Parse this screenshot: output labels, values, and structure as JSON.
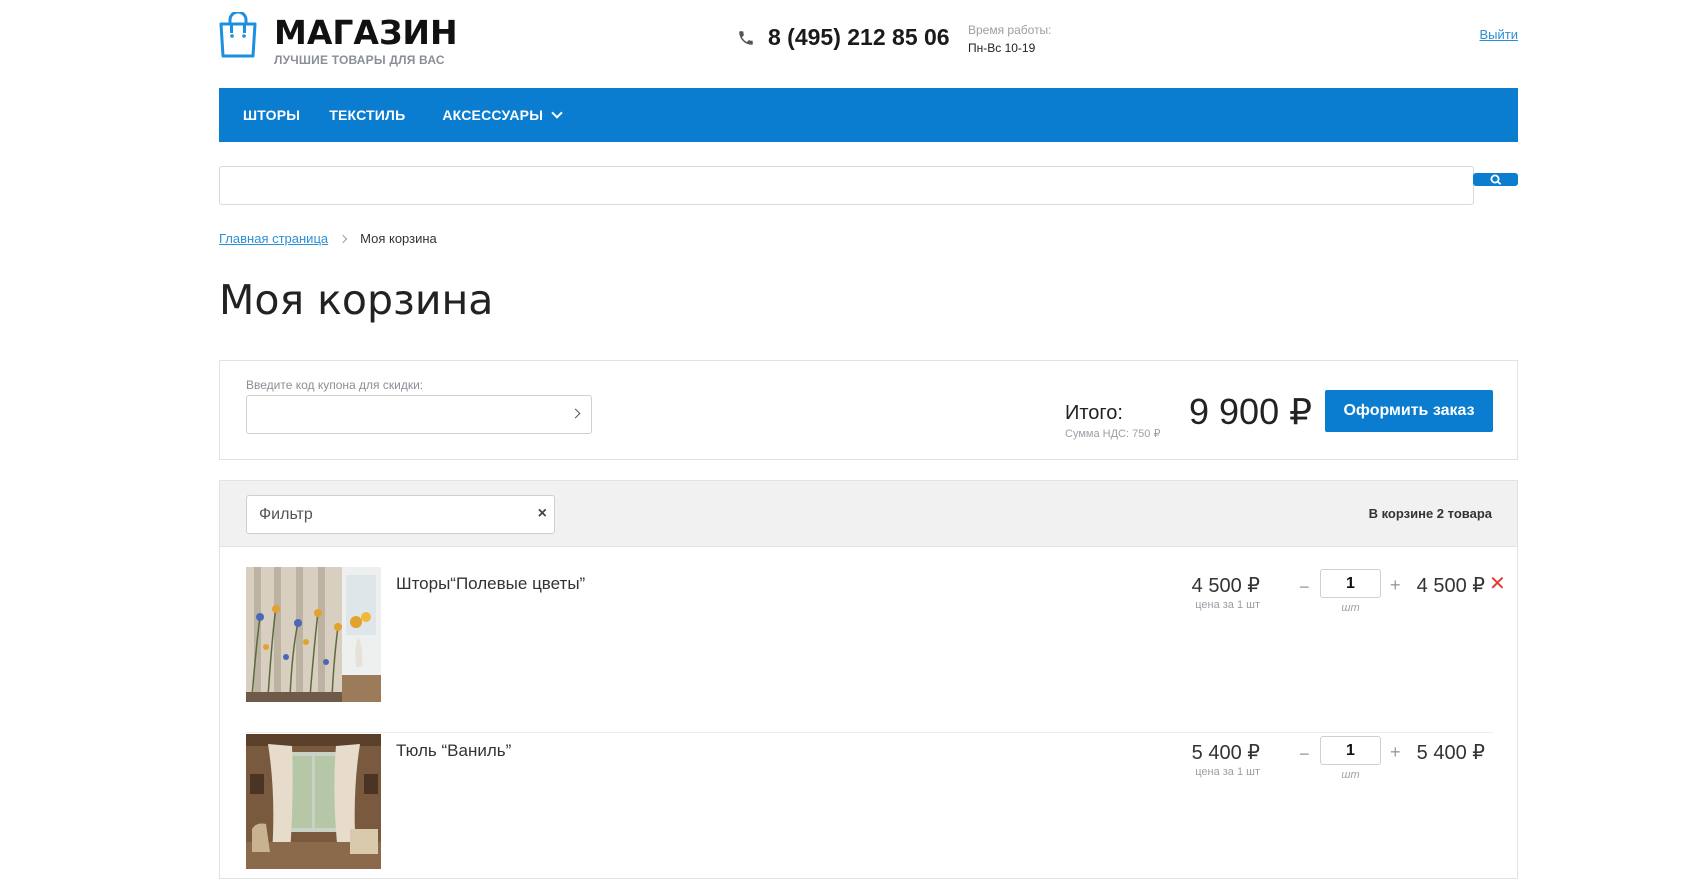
{
  "header": {
    "logo_title": "МАГАЗИН",
    "logo_subtitle": "ЛУЧШИЕ ТОВАРЫ ДЛЯ ВАС",
    "phone": "8 (495) 212 85 06",
    "hours_label": "Время работы:",
    "hours_value": "Пн-Вс 10-19",
    "logout": "Выйти"
  },
  "nav": {
    "items": [
      {
        "label": "ШТОРЫ"
      },
      {
        "label": "ТЕКСТИЛЬ"
      },
      {
        "label": "АКСЕССУАРЫ"
      }
    ]
  },
  "breadcrumb": {
    "home": "Главная страница",
    "current": "Моя корзина"
  },
  "page_title": "Моя корзина",
  "summary": {
    "coupon_label": "Введите код купона для скидки:",
    "coupon_value": "",
    "total_label": "Итого:",
    "vat": "Сумма НДС: 750 ₽",
    "total_value": "9 900 ₽",
    "checkout_label": "Оформить заказ"
  },
  "cart": {
    "filter_placeholder": "Фильтр",
    "filter_clear": "×",
    "count": "В корзине 2 товара",
    "items": [
      {
        "name": "Шторы“Полевые цветы”",
        "price": "4 500 ₽",
        "price_note": "цена за 1 шт",
        "qty": "1",
        "unit": "шт",
        "sum": "4 500 ₽",
        "remove": "✕"
      },
      {
        "name": "Тюль “Ваниль”",
        "price": "5 400 ₽",
        "price_note": "цена за 1 шт",
        "qty": "1",
        "unit": "шт",
        "sum": "5 400 ₽"
      }
    ],
    "minus": "−",
    "plus": "+"
  },
  "colors": {
    "brand": "#0a7dd1",
    "link": "#2a8fd6",
    "remove": "#e53935"
  }
}
